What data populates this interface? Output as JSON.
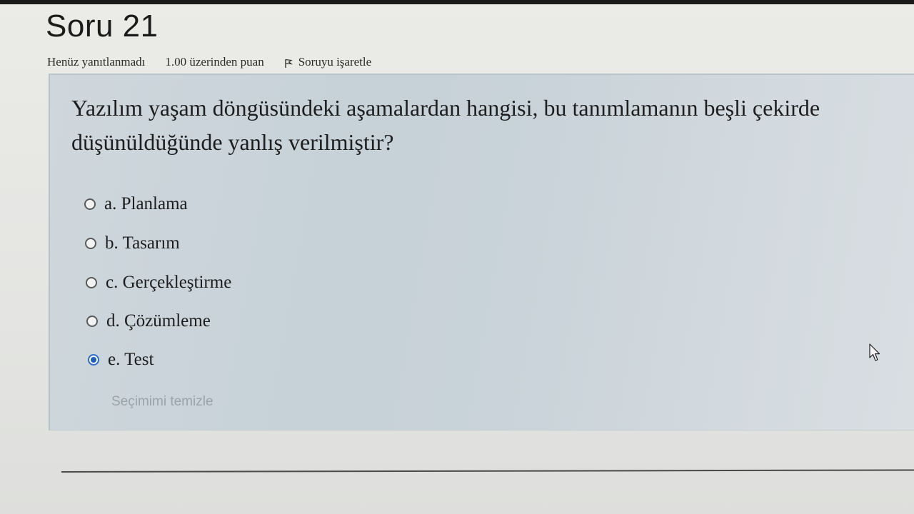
{
  "question": {
    "title": "Soru 21",
    "status": "Henüz yanıtlanmadı",
    "points": "1.00 üzerinden puan",
    "flag_label": "Soruyu işaretle",
    "text_line1": "Yazılım yaşam döngüsündeki aşamalardan hangisi, bu tanımlamanın beşli çekirde",
    "text_line2": "düşünüldüğünde yanlış verilmiştir?"
  },
  "options": [
    {
      "label": "a. Planlama",
      "selected": false
    },
    {
      "label": "b. Tasarım",
      "selected": false
    },
    {
      "label": "c. Gerçekleştirme",
      "selected": false
    },
    {
      "label": "d. Çözümleme",
      "selected": false
    },
    {
      "label": "e. Test",
      "selected": true
    }
  ],
  "clear_selection_label": "Seçimimi temizle",
  "colors": {
    "radio_selected": "#1f5fb8",
    "panel_bg": "#c9d3d9"
  },
  "icons": {
    "flag": "flag-icon",
    "cursor": "mouse-pointer-icon"
  }
}
